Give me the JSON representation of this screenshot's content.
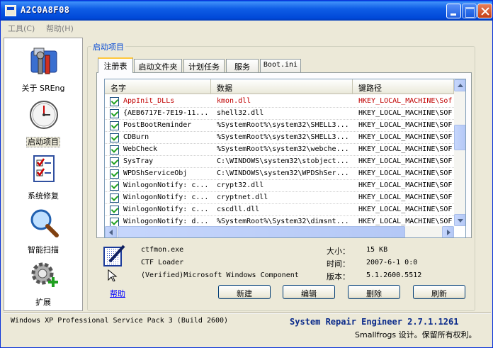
{
  "window": {
    "title": "A2C0A8F08"
  },
  "menu": [
    {
      "label": "工具(C)"
    },
    {
      "label": "帮助(H)"
    }
  ],
  "sidebar": {
    "items": [
      {
        "label": "关于 SREng",
        "icon": "tools-icon"
      },
      {
        "label": "启动项目",
        "icon": "clock-icon"
      },
      {
        "label": "系统修复",
        "icon": "checklist-icon"
      },
      {
        "label": "智能扫描",
        "icon": "magnifier-icon"
      },
      {
        "label": "扩展",
        "icon": "gear-plus-icon"
      }
    ]
  },
  "group": {
    "title": "启动项目"
  },
  "tabs": [
    {
      "label": "注册表"
    },
    {
      "label": "启动文件夹"
    },
    {
      "label": "计划任务"
    },
    {
      "label": "服务"
    },
    {
      "label": "Boot.ini"
    }
  ],
  "list": {
    "columns": [
      "名字",
      "数据",
      "键路径"
    ],
    "rows": [
      {
        "name": "AppInit_DLLs",
        "data": "kmon.dll",
        "key": "HKEY_LOCAL_MACHINE\\Sof",
        "highlight": true
      },
      {
        "name": "{AEB6717E-7E19-11...",
        "data": "shell32.dll",
        "key": "HKEY_LOCAL_MACHINE\\SOF",
        "highlight": false
      },
      {
        "name": "PostBootReminder",
        "data": "%SystemRoot%\\system32\\SHELL3...",
        "key": "HKEY_LOCAL_MACHINE\\SOF",
        "highlight": false
      },
      {
        "name": "CDBurn",
        "data": "%SystemRoot%\\system32\\SHELL3...",
        "key": "HKEY_LOCAL_MACHINE\\SOF",
        "highlight": false
      },
      {
        "name": "WebCheck",
        "data": "%SystemRoot%\\system32\\webche...",
        "key": "HKEY_LOCAL_MACHINE\\SOF",
        "highlight": false
      },
      {
        "name": "SysTray",
        "data": "C:\\WINDOWS\\system32\\stobject...",
        "key": "HKEY_LOCAL_MACHINE\\SOF",
        "highlight": false
      },
      {
        "name": "WPDShServiceObj",
        "data": "C:\\WINDOWS\\system32\\WPDShSer...",
        "key": "HKEY_LOCAL_MACHINE\\SOF",
        "highlight": false
      },
      {
        "name": "WinlogonNotify: c...",
        "data": "crypt32.dll",
        "key": "HKEY_LOCAL_MACHINE\\SOF",
        "highlight": false
      },
      {
        "name": "WinlogonNotify: c...",
        "data": "cryptnet.dll",
        "key": "HKEY_LOCAL_MACHINE\\SOF",
        "highlight": false
      },
      {
        "name": "WinlogonNotify: c...",
        "data": "cscdll.dll",
        "key": "HKEY_LOCAL_MACHINE\\SOF",
        "highlight": false
      },
      {
        "name": "WinlogonNotify: d...",
        "data": "%SystemRoot%\\System32\\dimsnt...",
        "key": "HKEY_LOCAL_MACHINE\\SOF",
        "highlight": false
      }
    ]
  },
  "details": {
    "filename": "ctfmon.exe",
    "description": "CTF Loader",
    "company": "(Verified)Microsoft Windows Component",
    "size_label": "大小：",
    "size": "15 KB",
    "time_label": "时间：",
    "time": "2007-6-1 0:0",
    "version_label": "版本：",
    "version": "5.1.2600.5512"
  },
  "actions": {
    "help": "帮助",
    "new": "新建",
    "edit": "编辑",
    "delete": "删除",
    "refresh": "刷新"
  },
  "status": {
    "os": "Windows XP Professional Service Pack 3 (Build 2600)",
    "product": "System Repair Engineer 2.7.1.1261",
    "copyright": "Smallfrogs 设计。保留所有权利。"
  },
  "colors": {
    "titlebar": "#0a5ee8",
    "highlight_text": "#c00000",
    "link": "#0000ff",
    "product_text": "#0a2a8a"
  }
}
